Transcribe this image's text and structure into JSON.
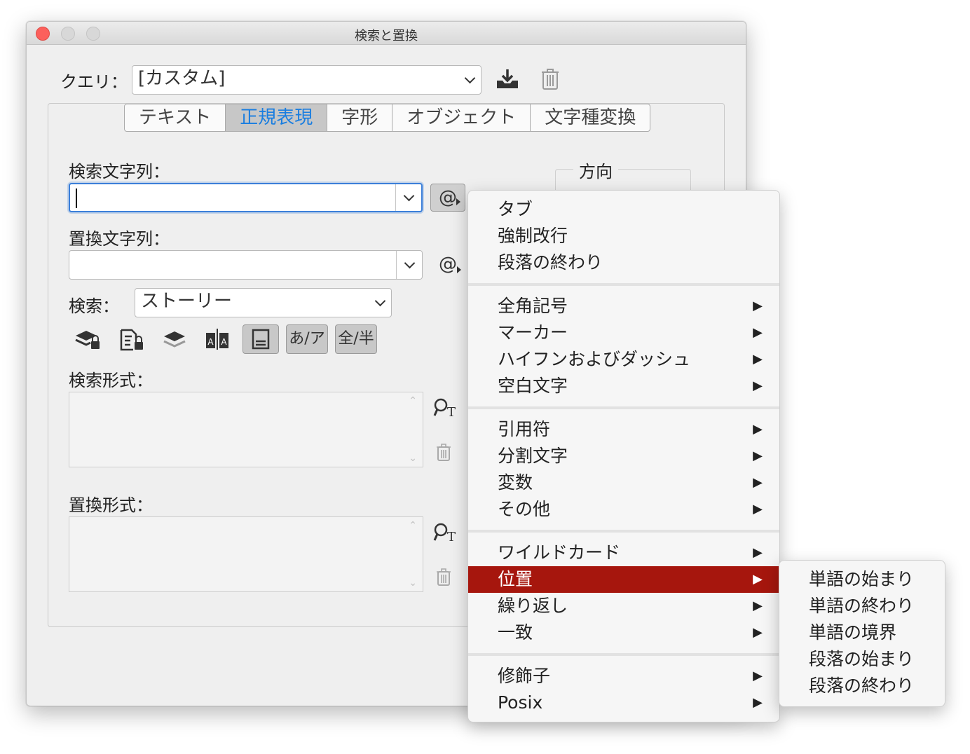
{
  "window": {
    "title": "検索と置換"
  },
  "query": {
    "label": "クエリ：",
    "value": "[カスタム]",
    "save_icon": "save-query-icon",
    "delete_icon": "trash-icon"
  },
  "tabs": [
    {
      "label": "テキスト",
      "active": false
    },
    {
      "label": "正規表現",
      "active": true
    },
    {
      "label": "字形",
      "active": false
    },
    {
      "label": "オブジェクト",
      "active": false
    },
    {
      "label": "文字種変換",
      "active": false
    }
  ],
  "find": {
    "label": "検索文字列：",
    "value": "",
    "special_button": "@"
  },
  "replace": {
    "label": "置換文字列：",
    "value": "",
    "special_button": "@"
  },
  "direction": {
    "label": "方向"
  },
  "search": {
    "label": "検索：",
    "value": "ストーリー"
  },
  "options": {
    "kana_label": "あ/ア",
    "width_label": "全/半"
  },
  "find_format": {
    "label": "検索形式："
  },
  "change_format": {
    "label": "置換形式："
  },
  "menu": {
    "groups": [
      [
        {
          "label": "タブ",
          "submenu": false
        },
        {
          "label": "強制改行",
          "submenu": false
        },
        {
          "label": "段落の終わり",
          "submenu": false
        }
      ],
      [
        {
          "label": "全角記号",
          "submenu": true
        },
        {
          "label": "マーカー",
          "submenu": true
        },
        {
          "label": "ハイフンおよびダッシュ",
          "submenu": true
        },
        {
          "label": "空白文字",
          "submenu": true
        }
      ],
      [
        {
          "label": "引用符",
          "submenu": true
        },
        {
          "label": "分割文字",
          "submenu": true
        },
        {
          "label": "変数",
          "submenu": true
        },
        {
          "label": "その他",
          "submenu": true
        }
      ],
      [
        {
          "label": "ワイルドカード",
          "submenu": true
        },
        {
          "label": "位置",
          "submenu": true,
          "selected": true
        },
        {
          "label": "繰り返し",
          "submenu": true
        },
        {
          "label": "一致",
          "submenu": true
        }
      ],
      [
        {
          "label": "修飾子",
          "submenu": true
        },
        {
          "label": "Posix",
          "submenu": true
        }
      ]
    ],
    "arrow": "▶"
  },
  "submenu": {
    "items": [
      "単語の始まり",
      "単語の終わり",
      "単語の境界",
      "段落の始まり",
      "段落の終わり"
    ]
  },
  "colors": {
    "selection": "#a6160d",
    "focus": "#3b7fd9",
    "active_tab_text": "#1a7ee0"
  }
}
